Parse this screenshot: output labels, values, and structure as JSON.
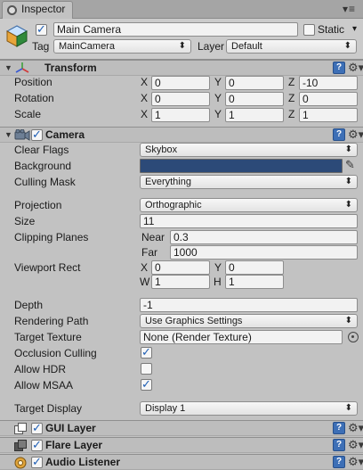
{
  "window": {
    "tab_label": "Inspector",
    "menu_glyph": "▾≡"
  },
  "header": {
    "object_name": "Main Camera",
    "active": true,
    "static_label": "Static",
    "static_checked": false,
    "static_arrow": "▾",
    "tag_label": "Tag",
    "tag_value": "MainCamera",
    "layer_label": "Layer",
    "layer_value": "Default"
  },
  "transform": {
    "title": "Transform",
    "rows": [
      {
        "label": "Position",
        "x": "0",
        "y": "0",
        "z": "-10"
      },
      {
        "label": "Rotation",
        "x": "0",
        "y": "0",
        "z": "0"
      },
      {
        "label": "Scale",
        "x": "1",
        "y": "1",
        "z": "1"
      }
    ],
    "axes": {
      "x": "X",
      "y": "Y",
      "z": "Z"
    }
  },
  "camera": {
    "title": "Camera",
    "enabled": true,
    "clear_flags_label": "Clear Flags",
    "clear_flags_value": "Skybox",
    "background_label": "Background",
    "background_color": "#2c4a78",
    "culling_mask_label": "Culling Mask",
    "culling_mask_value": "Everything",
    "projection_label": "Projection",
    "projection_value": "Orthographic",
    "size_label": "Size",
    "size_value": "11",
    "clipping_label": "Clipping Planes",
    "near_label": "Near",
    "near_value": "0.3",
    "far_label": "Far",
    "far_value": "1000",
    "viewport_label": "Viewport Rect",
    "viewport": {
      "x": "0",
      "y": "0",
      "w": "1",
      "h": "1"
    },
    "viewport_axes": {
      "x": "X",
      "y": "Y",
      "w": "W",
      "h": "H"
    },
    "depth_label": "Depth",
    "depth_value": "-1",
    "rendering_path_label": "Rendering Path",
    "rendering_path_value": "Use Graphics Settings",
    "target_texture_label": "Target Texture",
    "target_texture_value": "None (Render Texture)",
    "occlusion_label": "Occlusion Culling",
    "occlusion_checked": true,
    "hdr_label": "Allow HDR",
    "hdr_checked": false,
    "msaa_label": "Allow MSAA",
    "msaa_checked": true,
    "target_display_label": "Target Display",
    "target_display_value": "Display 1"
  },
  "components": [
    {
      "title": "GUI Layer",
      "enabled": true
    },
    {
      "title": "Flare Layer",
      "enabled": true
    },
    {
      "title": "Audio Listener",
      "enabled": true
    }
  ],
  "icons": {
    "help": "?",
    "gear": "⚙▾",
    "dropdown_arrow": "⬍",
    "foldout_open": "▼",
    "eyedropper": "✎"
  },
  "colors": {
    "accent_blue": "#3d6fb6",
    "background_swatch": "#2c4a78"
  }
}
